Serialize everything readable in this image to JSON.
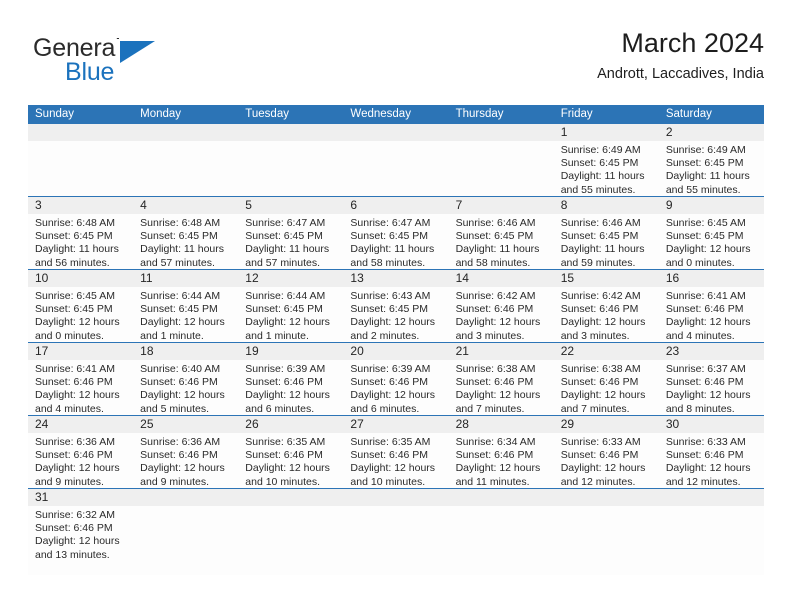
{
  "brand": {
    "word1": "General",
    "word2": "Blue",
    "logo_icon": "triangle-logo-icon",
    "accent_color": "#1b72bd"
  },
  "header": {
    "month_title": "March 2024",
    "location": "Andrott, Laccadives, India"
  },
  "calendar": {
    "header_color": "#2c74b6",
    "band_color": "#efefef",
    "day_names": [
      "Sunday",
      "Monday",
      "Tuesday",
      "Wednesday",
      "Thursday",
      "Friday",
      "Saturday"
    ],
    "weeks": [
      [
        {
          "day": "",
          "lines": []
        },
        {
          "day": "",
          "lines": []
        },
        {
          "day": "",
          "lines": []
        },
        {
          "day": "",
          "lines": []
        },
        {
          "day": "",
          "lines": []
        },
        {
          "day": "1",
          "lines": [
            "Sunrise: 6:49 AM",
            "Sunset: 6:45 PM",
            "Daylight: 11 hours",
            "and 55 minutes."
          ]
        },
        {
          "day": "2",
          "lines": [
            "Sunrise: 6:49 AM",
            "Sunset: 6:45 PM",
            "Daylight: 11 hours",
            "and 55 minutes."
          ]
        }
      ],
      [
        {
          "day": "3",
          "lines": [
            "Sunrise: 6:48 AM",
            "Sunset: 6:45 PM",
            "Daylight: 11 hours",
            "and 56 minutes."
          ]
        },
        {
          "day": "4",
          "lines": [
            "Sunrise: 6:48 AM",
            "Sunset: 6:45 PM",
            "Daylight: 11 hours",
            "and 57 minutes."
          ]
        },
        {
          "day": "5",
          "lines": [
            "Sunrise: 6:47 AM",
            "Sunset: 6:45 PM",
            "Daylight: 11 hours",
            "and 57 minutes."
          ]
        },
        {
          "day": "6",
          "lines": [
            "Sunrise: 6:47 AM",
            "Sunset: 6:45 PM",
            "Daylight: 11 hours",
            "and 58 minutes."
          ]
        },
        {
          "day": "7",
          "lines": [
            "Sunrise: 6:46 AM",
            "Sunset: 6:45 PM",
            "Daylight: 11 hours",
            "and 58 minutes."
          ]
        },
        {
          "day": "8",
          "lines": [
            "Sunrise: 6:46 AM",
            "Sunset: 6:45 PM",
            "Daylight: 11 hours",
            "and 59 minutes."
          ]
        },
        {
          "day": "9",
          "lines": [
            "Sunrise: 6:45 AM",
            "Sunset: 6:45 PM",
            "Daylight: 12 hours",
            "and 0 minutes."
          ]
        }
      ],
      [
        {
          "day": "10",
          "lines": [
            "Sunrise: 6:45 AM",
            "Sunset: 6:45 PM",
            "Daylight: 12 hours",
            "and 0 minutes."
          ]
        },
        {
          "day": "11",
          "lines": [
            "Sunrise: 6:44 AM",
            "Sunset: 6:45 PM",
            "Daylight: 12 hours",
            "and 1 minute."
          ]
        },
        {
          "day": "12",
          "lines": [
            "Sunrise: 6:44 AM",
            "Sunset: 6:45 PM",
            "Daylight: 12 hours",
            "and 1 minute."
          ]
        },
        {
          "day": "13",
          "lines": [
            "Sunrise: 6:43 AM",
            "Sunset: 6:45 PM",
            "Daylight: 12 hours",
            "and 2 minutes."
          ]
        },
        {
          "day": "14",
          "lines": [
            "Sunrise: 6:42 AM",
            "Sunset: 6:46 PM",
            "Daylight: 12 hours",
            "and 3 minutes."
          ]
        },
        {
          "day": "15",
          "lines": [
            "Sunrise: 6:42 AM",
            "Sunset: 6:46 PM",
            "Daylight: 12 hours",
            "and 3 minutes."
          ]
        },
        {
          "day": "16",
          "lines": [
            "Sunrise: 6:41 AM",
            "Sunset: 6:46 PM",
            "Daylight: 12 hours",
            "and 4 minutes."
          ]
        }
      ],
      [
        {
          "day": "17",
          "lines": [
            "Sunrise: 6:41 AM",
            "Sunset: 6:46 PM",
            "Daylight: 12 hours",
            "and 4 minutes."
          ]
        },
        {
          "day": "18",
          "lines": [
            "Sunrise: 6:40 AM",
            "Sunset: 6:46 PM",
            "Daylight: 12 hours",
            "and 5 minutes."
          ]
        },
        {
          "day": "19",
          "lines": [
            "Sunrise: 6:39 AM",
            "Sunset: 6:46 PM",
            "Daylight: 12 hours",
            "and 6 minutes."
          ]
        },
        {
          "day": "20",
          "lines": [
            "Sunrise: 6:39 AM",
            "Sunset: 6:46 PM",
            "Daylight: 12 hours",
            "and 6 minutes."
          ]
        },
        {
          "day": "21",
          "lines": [
            "Sunrise: 6:38 AM",
            "Sunset: 6:46 PM",
            "Daylight: 12 hours",
            "and 7 minutes."
          ]
        },
        {
          "day": "22",
          "lines": [
            "Sunrise: 6:38 AM",
            "Sunset: 6:46 PM",
            "Daylight: 12 hours",
            "and 7 minutes."
          ]
        },
        {
          "day": "23",
          "lines": [
            "Sunrise: 6:37 AM",
            "Sunset: 6:46 PM",
            "Daylight: 12 hours",
            "and 8 minutes."
          ]
        }
      ],
      [
        {
          "day": "24",
          "lines": [
            "Sunrise: 6:36 AM",
            "Sunset: 6:46 PM",
            "Daylight: 12 hours",
            "and 9 minutes."
          ]
        },
        {
          "day": "25",
          "lines": [
            "Sunrise: 6:36 AM",
            "Sunset: 6:46 PM",
            "Daylight: 12 hours",
            "and 9 minutes."
          ]
        },
        {
          "day": "26",
          "lines": [
            "Sunrise: 6:35 AM",
            "Sunset: 6:46 PM",
            "Daylight: 12 hours",
            "and 10 minutes."
          ]
        },
        {
          "day": "27",
          "lines": [
            "Sunrise: 6:35 AM",
            "Sunset: 6:46 PM",
            "Daylight: 12 hours",
            "and 10 minutes."
          ]
        },
        {
          "day": "28",
          "lines": [
            "Sunrise: 6:34 AM",
            "Sunset: 6:46 PM",
            "Daylight: 12 hours",
            "and 11 minutes."
          ]
        },
        {
          "day": "29",
          "lines": [
            "Sunrise: 6:33 AM",
            "Sunset: 6:46 PM",
            "Daylight: 12 hours",
            "and 12 minutes."
          ]
        },
        {
          "day": "30",
          "lines": [
            "Sunrise: 6:33 AM",
            "Sunset: 6:46 PM",
            "Daylight: 12 hours",
            "and 12 minutes."
          ]
        }
      ],
      [
        {
          "day": "31",
          "lines": [
            "Sunrise: 6:32 AM",
            "Sunset: 6:46 PM",
            "Daylight: 12 hours",
            "and 13 minutes."
          ]
        },
        {
          "day": "",
          "lines": []
        },
        {
          "day": "",
          "lines": []
        },
        {
          "day": "",
          "lines": []
        },
        {
          "day": "",
          "lines": []
        },
        {
          "day": "",
          "lines": []
        },
        {
          "day": "",
          "lines": []
        }
      ]
    ]
  }
}
